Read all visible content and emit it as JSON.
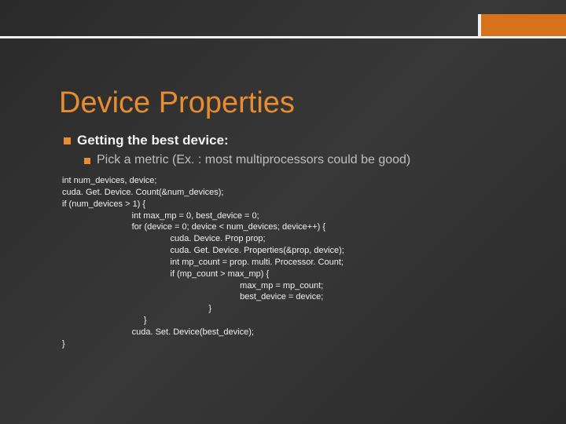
{
  "title": "Device Properties",
  "bullet1": "Getting the best device:",
  "bullet2": "Pick a metric (Ex. : most multiprocessors could be good)",
  "code": "int num_devices, device;\ncuda. Get. Device. Count(&num_devices);\nif (num_devices > 1) {\n                             int max_mp = 0, best_device = 0;\n                             for (device = 0; device < num_devices; device++) {\n                                             cuda. Device. Prop prop;\n                                             cuda. Get. Device. Properties(&prop, device);\n                                             int mp_count = prop. multi. Processor. Count;\n                                             if (mp_count > max_mp) {\n                                                                          max_mp = mp_count;\n                                                                          best_device = device;\n                                                             }\n                                  }\n                             cuda. Set. Device(best_device);\n}"
}
